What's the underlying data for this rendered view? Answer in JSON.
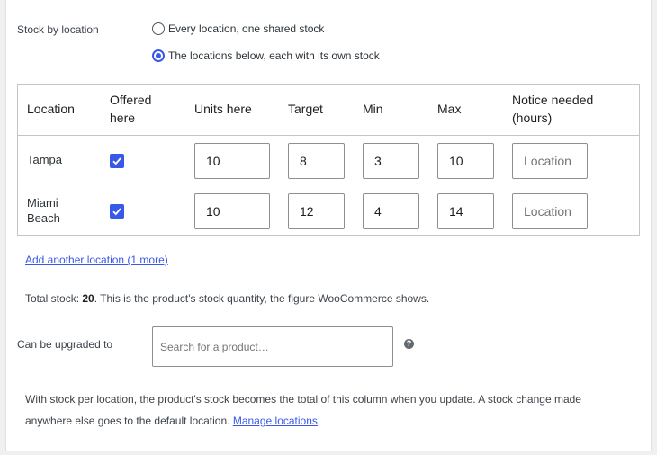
{
  "stock_by_location": {
    "label": "Stock by location",
    "options": [
      {
        "label": "Every location, one shared stock",
        "checked": false
      },
      {
        "label": "The locations below, each with its own stock",
        "checked": true
      }
    ]
  },
  "table": {
    "headers": {
      "location": "Location",
      "offered_1": "Offered",
      "offered_2": "here",
      "units": "Units here",
      "target": "Target",
      "min": "Min",
      "max": "Max",
      "notice_1": "Notice needed",
      "notice_2": "(hours)"
    },
    "rows": [
      {
        "name_1": "Tampa",
        "name_2": "",
        "offered": true,
        "units": "10",
        "target": "8",
        "min": "3",
        "max": "10",
        "notice_placeholder": "Location"
      },
      {
        "name_1": "Miami",
        "name_2": "Beach",
        "offered": true,
        "units": "10",
        "target": "12",
        "min": "4",
        "max": "14",
        "notice_placeholder": "Location"
      }
    ]
  },
  "add_location_link": "Add another location (1 more)",
  "total_stock": {
    "prefix": "Total stock: ",
    "value": "20",
    "suffix": ". This is the product's stock quantity, the figure WooCommerce shows."
  },
  "upgrade": {
    "label": "Can be upgraded to",
    "placeholder": "Search for a product…",
    "help_icon": "?"
  },
  "note": {
    "line1": "With stock per location, the product's stock becomes the total of this column when you update. A stock change made",
    "line2": "anywhere else goes to the default location. ",
    "link": "Manage locations"
  },
  "colors": {
    "accent": "#3858e9",
    "border": "#c3c4c7"
  }
}
